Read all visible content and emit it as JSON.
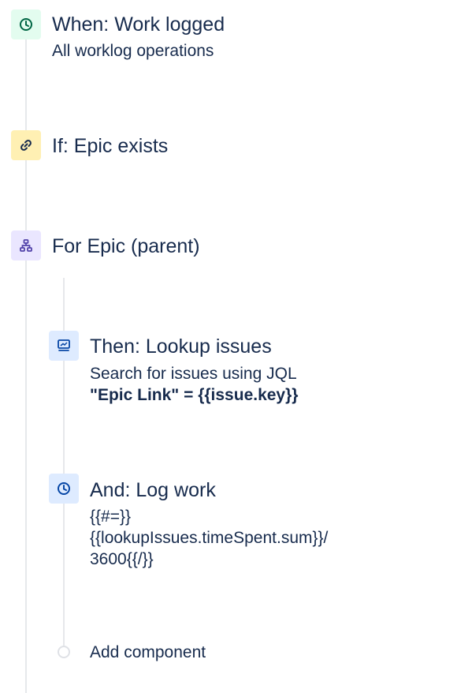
{
  "trigger": {
    "icon": "clock-icon",
    "color": "#e3fcef",
    "title": "When: Work logged",
    "subtitle": "All worklog operations"
  },
  "condition": {
    "icon": "link-icon",
    "color": "#fff0b3",
    "title": "If: Epic exists"
  },
  "branch": {
    "icon": "hierarchy-icon",
    "color": "#eae6ff",
    "title": "For Epic (parent)"
  },
  "action_lookup": {
    "icon": "monitor-icon",
    "color": "#deebff",
    "title": "Then: Lookup issues",
    "subtitle": "Search for issues using JQL",
    "jql": "\"Epic Link\" = {{issue.key}}"
  },
  "action_log": {
    "icon": "clock-icon",
    "color": "#deebff",
    "title": "And: Log work",
    "lines": [
      "{{#=}}",
      "{{lookupIssues.timeSpent.sum}}/",
      "3600{{/}}"
    ]
  },
  "add_component": {
    "label": "Add component"
  }
}
